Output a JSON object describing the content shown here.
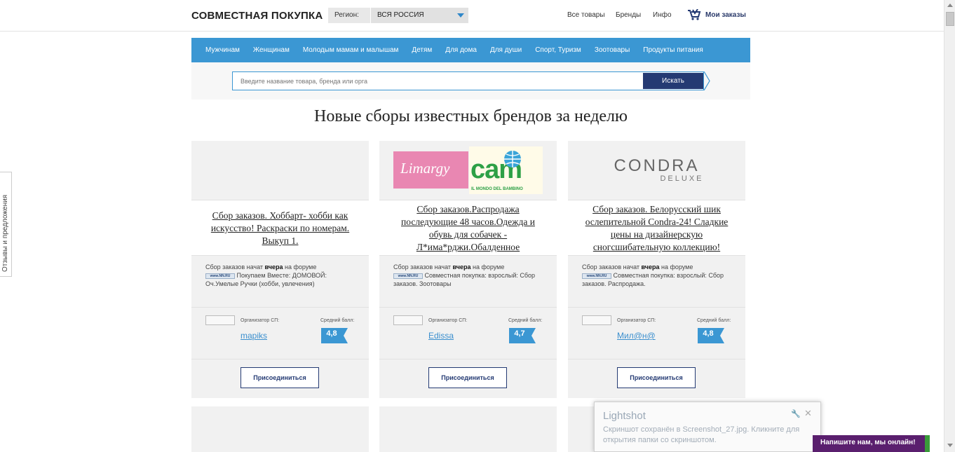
{
  "header": {
    "logo": "СОВМЕСТНАЯ ПОКУПКА",
    "region_label": "Регион:",
    "region_value": "ВСЯ РОССИЯ",
    "nav": [
      "Все товары",
      "Бренды",
      "Инфо"
    ],
    "orders": "Мои заказы"
  },
  "categories": [
    "Мужчинам",
    "Женщинам",
    "Молодым мамам и малышам",
    "Детям",
    "Для дома",
    "Для души",
    "Спорт, Туризм",
    "Зоотовары",
    "Продукты питания"
  ],
  "search": {
    "placeholder": "Введите название товара, бренда или орга",
    "button": "Искать"
  },
  "main_heading": "Новые сборы известных брендов за неделю",
  "cards": [
    {
      "title": "Сбор заказов. Хоббарт- хобби как искусство! Раскраски по номерам. Выкуп 1.",
      "info_prefix": "Сбор заказов начат ",
      "info_bold": "вчера",
      "info_suffix": " на форуме",
      "forum_text": "Покупаем Вместе: ДОМОВОЙ: Оч.Умелые Ручки (хобби, увлечения)",
      "org_label": "Организатор СП:",
      "org_name": "mapiks",
      "score_label": "Средний балл:",
      "score": "4,8",
      "join": "Присоединиться"
    },
    {
      "title": "Сбор заказов.Распродажа последующие 48 часов.Одежда и обувь для собачек - Л*има*рджи.Обалденное",
      "info_prefix": "Сбор заказов начат ",
      "info_bold": "вчера",
      "info_suffix": " на форуме",
      "forum_text": "Совместная покупка: взрослый: Сбор заказов. Зоотовары",
      "org_label": "Организатор СП:",
      "org_name": "Edissa",
      "score_label": "Средний балл:",
      "score": "4,7",
      "join": "Присоединиться",
      "logo_left": "Limargy",
      "logo_right": "cam",
      "logo_right_sub": "IL MONDO DEL BAMBINO"
    },
    {
      "title": "Сбор заказов. Белорусский шик ослепительной Condra-24! Сладкие цены на дизайнерскую сногсшибательную коллекцию!",
      "info_prefix": "Сбор заказов начат ",
      "info_bold": "вчера",
      "info_suffix": " на форуме",
      "forum_text": "Совместная покупка: взрослый: Сбор заказов. Распродажа.",
      "org_label": "Организатор СП:",
      "org_name": "Мил@н@",
      "score_label": "Средний балл:",
      "score": "4,8",
      "join": "Присоединиться",
      "logo": "CONDRA",
      "logo_sub": "DELUXE"
    }
  ],
  "forum_badge": "www.NN.RU",
  "feedback_tab": "Отзывы и предложения",
  "toast": {
    "title": "Lightshot",
    "text": "Скриншот сохранён в Screenshot_27.jpg. Кликните для открытия папки со скриншотом."
  },
  "chat": "Напишите нам, мы онлайн!",
  "colors": {
    "nav_blue": "#3b97d3",
    "dark_blue": "#243a73",
    "chat_purple": "#5a1f6e"
  }
}
